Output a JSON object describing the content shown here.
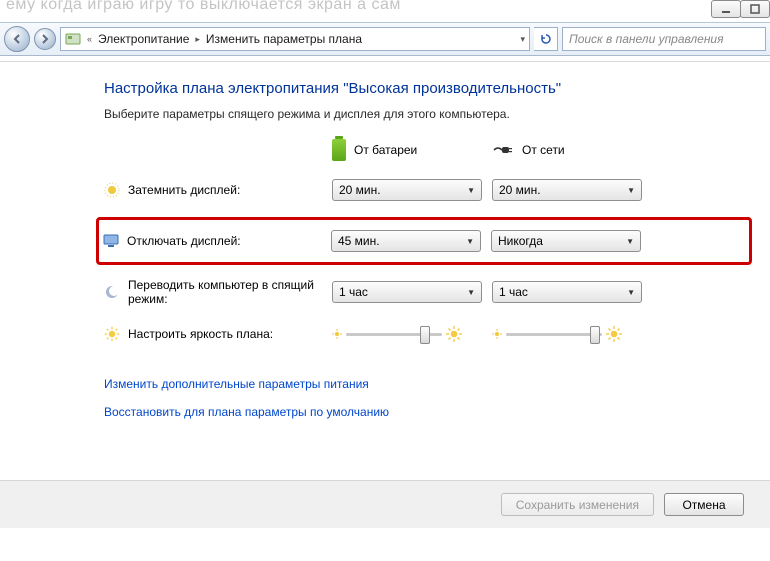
{
  "ghost_header": "ему когда играю игру то выключается экран а сам",
  "breadcrumb": {
    "prefix": "«",
    "item1": "Электропитание",
    "item2": "Изменить параметры плана"
  },
  "search": {
    "placeholder": "Поиск в панели управления"
  },
  "title": "Настройка плана электропитания \"Высокая производительность\"",
  "subtitle": "Выберите параметры спящего режима и дисплея для этого компьютера.",
  "cols": {
    "battery": "От батареи",
    "ac": "От сети"
  },
  "rows": {
    "dim": {
      "label": "Затемнить дисплей:",
      "battery": "20 мин.",
      "ac": "20 мин."
    },
    "off": {
      "label": "Отключать дисплей:",
      "battery": "45 мин.",
      "ac": "Никогда"
    },
    "sleep": {
      "label": "Переводить компьютер в спящий режим:",
      "battery": "1 час",
      "ac": "1 час"
    },
    "bright": {
      "label": "Настроить яркость плана:"
    }
  },
  "links": {
    "advanced": "Изменить дополнительные параметры питания",
    "restore": "Восстановить для плана параметры по умолчанию"
  },
  "buttons": {
    "save": "Сохранить изменения",
    "cancel": "Отмена"
  }
}
